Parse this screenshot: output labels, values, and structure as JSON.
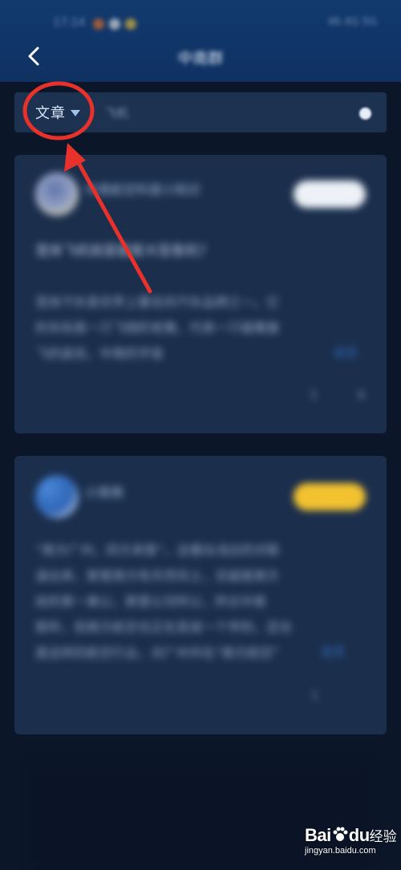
{
  "status_bar": {
    "time": "17:14",
    "right": "46 4G 5G"
  },
  "header": {
    "title": "中南群"
  },
  "search": {
    "filter_label": "文章",
    "placeholder": "飞机"
  },
  "cards": [
    {
      "author": "中南航空科普小知识",
      "meta": "",
      "title": "宽体飞机就是载客大型客机?",
      "lines": [
        "宽体汽车是世界上著名的汽车品牌之一。它",
        "的车标是一只飞翔的老鹰，代表一只雄鹰展",
        "飞的姿态，中南的宇宙"
      ],
      "more": "全文",
      "likes": "3",
      "comments": "8"
    },
    {
      "author": "小南南",
      "meta": "",
      "title": "",
      "lines": [
        "“南方广州，四方来客”，这看似浅白的对联",
        "道出来，那里南方有天然风土，无疑是南方",
        "给的第一美公，那里公司所公，所论中是",
        "那所，但南方航空也正在变成一个学的，还也",
        "是这样的航空行业，对广州市在“南方航空”"
      ],
      "more": "全文",
      "likes": "1",
      "comments": ""
    }
  ],
  "watermark": {
    "brand": "Bai",
    "brand2": "du",
    "brand3": "经验",
    "url": "jingyan.baidu.com"
  },
  "colors": {
    "header": "#123a6e",
    "background": "#0b1628",
    "card": "#1b2f4d",
    "accent": "#f2c230",
    "annotation": "#e8312b"
  }
}
